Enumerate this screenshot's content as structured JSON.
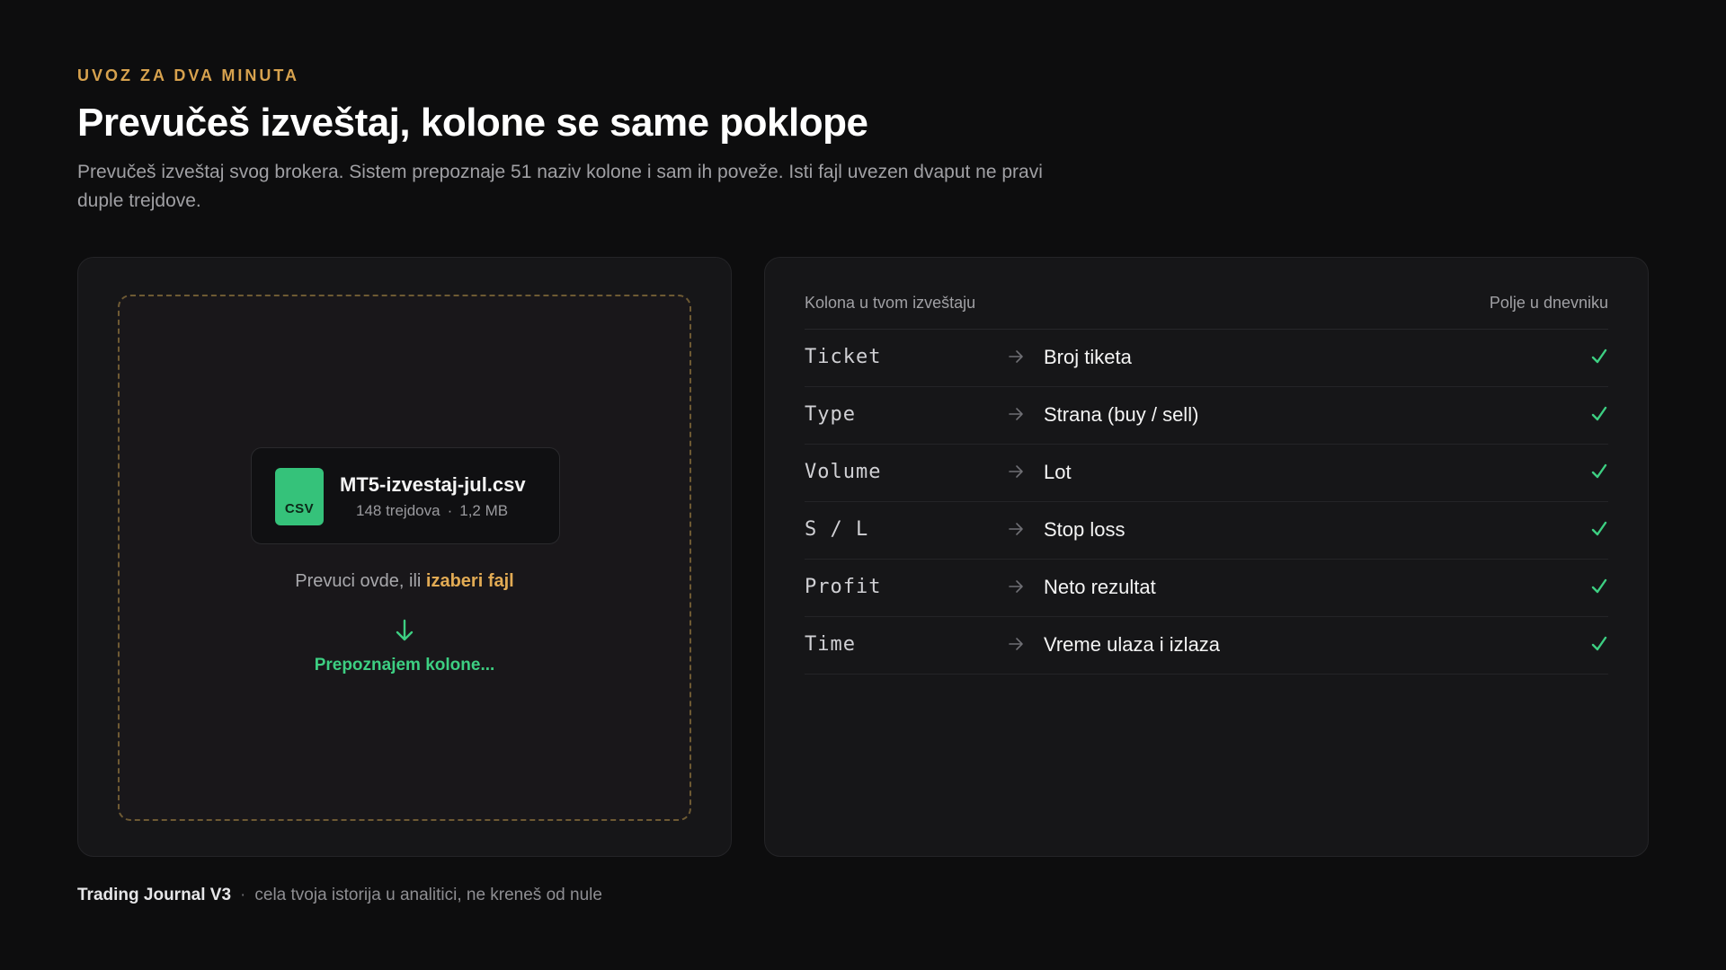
{
  "header": {
    "eyebrow": "UVOZ ZA DVA MINUTA",
    "title": "Prevučeš izveštaj, kolone se same poklope",
    "subtitle": "Prevučeš izveštaj svog brokera. Sistem prepoznaje 51 naziv kolone i sam ih poveže. Isti fajl uvezen dvaput ne pravi duple trejdove."
  },
  "upload": {
    "file": {
      "badge": "CSV",
      "name": "MT5-izvestaj-jul.csv",
      "trades": "148 trejdova",
      "separator": "·",
      "size": "1,2 MB"
    },
    "hint_prefix": "Prevuci ovde, ili ",
    "hint_link": "izaberi fajl",
    "status": "Prepoznajem kolone..."
  },
  "mapping": {
    "header_left": "Kolona u tvom izveštaju",
    "header_right": "Polje u dnevniku",
    "rows": [
      {
        "source": "Ticket",
        "target": "Broj tiketa"
      },
      {
        "source": "Type",
        "target": "Strana (buy / sell)"
      },
      {
        "source": "Volume",
        "target": "Lot"
      },
      {
        "source": "S / L",
        "target": "Stop loss"
      },
      {
        "source": "Profit",
        "target": "Neto rezultat"
      },
      {
        "source": "Time",
        "target": "Vreme ulaza i izlaza"
      }
    ]
  },
  "footer": {
    "brand": "Trading Journal V3",
    "separator": "·",
    "tagline": "cela tvoja istorija u analitici, ne kreneš od nule"
  },
  "colors": {
    "background": "#0d0d0e",
    "accent_gold": "#e2ab54",
    "accent_green": "#3dcf82"
  }
}
